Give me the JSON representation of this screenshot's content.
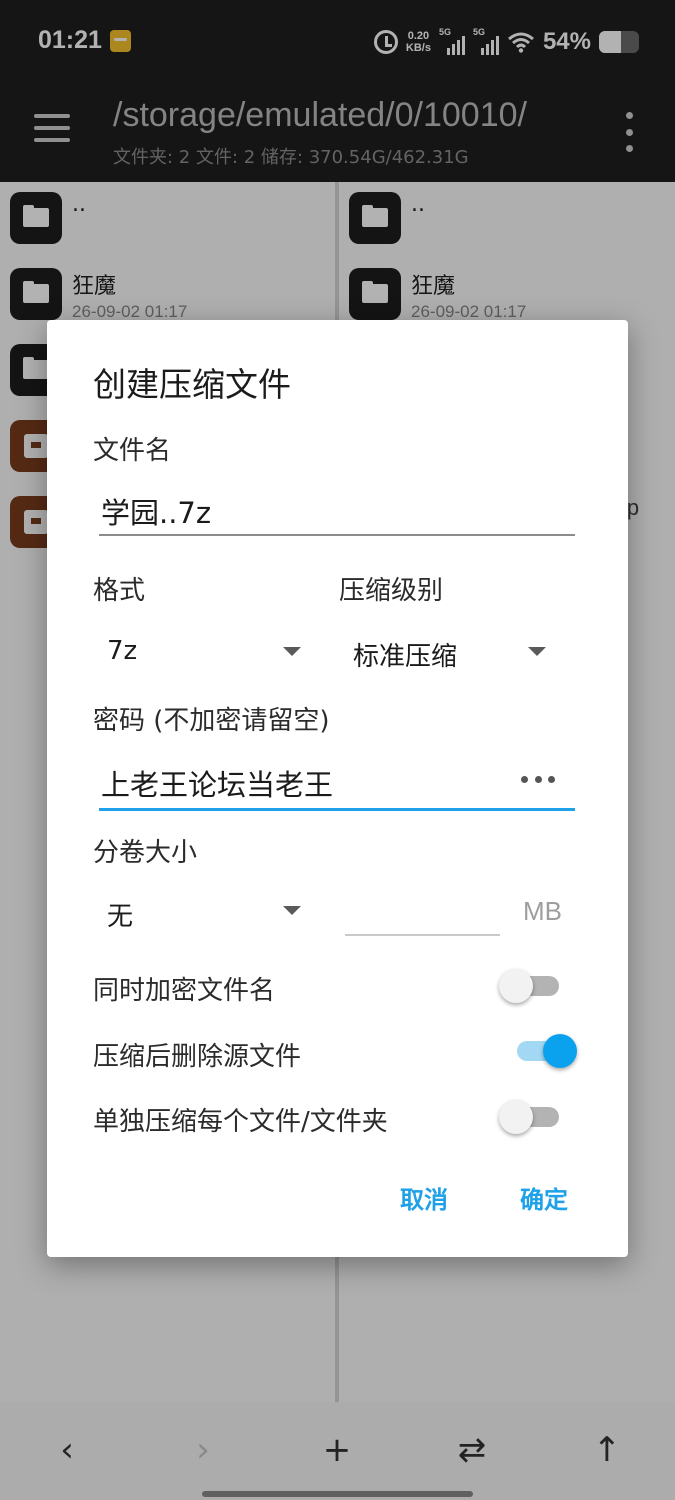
{
  "status_bar": {
    "time": "01:21",
    "net_speed_value": "0.20",
    "net_speed_unit": "KB/s",
    "sim1_tag": "5G",
    "sim2_tag": "5G",
    "battery_text": "54%",
    "battery_level": 0.54
  },
  "header": {
    "path": "/storage/emulated/0/10010/",
    "summary": "文件夹: 2  文件: 2  储存: 370.54G/462.31G"
  },
  "left_pane": {
    "rows": [
      {
        "name": "..",
        "date": "",
        "type": "folder"
      },
      {
        "name": "狂魔",
        "date": "26-09-02 01:17",
        "type": "folder"
      },
      {
        "name": "",
        "date": "",
        "type": "folder"
      },
      {
        "name": "",
        "date": "",
        "type": "archive"
      },
      {
        "name": "",
        "date": "",
        "type": "archive"
      }
    ]
  },
  "right_pane": {
    "rows": [
      {
        "name": "..",
        "date": "",
        "type": "folder"
      },
      {
        "name": "狂魔",
        "date": "26-09-02 01:17",
        "type": "folder"
      }
    ],
    "partial_text": "ip"
  },
  "dialog": {
    "title": "创建压缩文件",
    "filename_label": "文件名",
    "filename_value": "学园..7z",
    "format_label": "格式",
    "format_value": "7z",
    "level_label": "压缩级别",
    "level_value": "标准压缩",
    "password_label": "密码 (不加密请留空)",
    "password_value": "上老王论坛当老王",
    "split_label": "分卷大小",
    "split_value": "无",
    "split_size_value": "",
    "split_unit": "MB",
    "options": [
      {
        "label": "同时加密文件名",
        "checked": false
      },
      {
        "label": "压缩后删除源文件",
        "checked": true
      },
      {
        "label": "单独压缩每个文件/文件夹",
        "checked": false
      }
    ],
    "cancel_label": "取消",
    "ok_label": "确定"
  },
  "toolbar": {
    "back_glyph": "‹",
    "forward_glyph": "›",
    "add_glyph": "+",
    "swap_glyph": "⇄",
    "up_glyph": "↑"
  },
  "colors": {
    "accent": "#1ea1e8",
    "toggle_on": "#0aa2ee",
    "app_bar": "#1f1f1f"
  }
}
